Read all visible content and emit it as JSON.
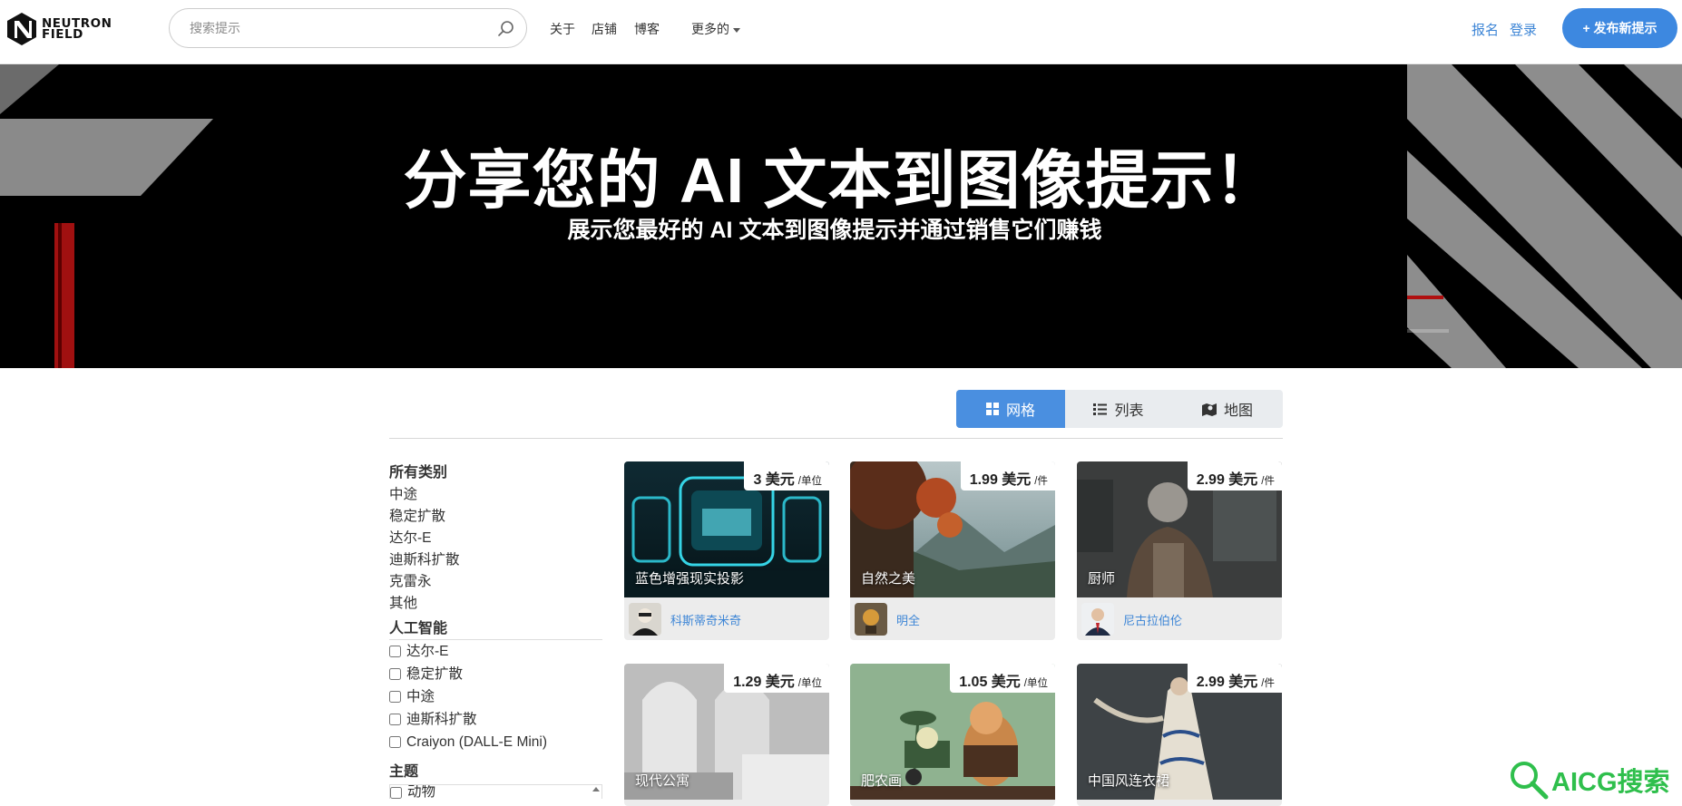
{
  "header": {
    "logo_line1": "NEUTRON",
    "logo_line2": "FIELD",
    "search_placeholder": "搜索提示",
    "nav": {
      "about": "关于",
      "shop": "店铺",
      "blog": "博客",
      "more": "更多的"
    },
    "auth": {
      "signup": "报名",
      "login": "登录"
    },
    "post_button": "+ 发布新提示",
    "accent": "#3d88e0"
  },
  "hero": {
    "title": "分享您的 AI 文本到图像提示！",
    "subtitle": "展示您最好的 AI 文本到图像提示并通过销售它们赚钱"
  },
  "views": {
    "grid": "网格",
    "list": "列表",
    "map": "地图",
    "active": "grid"
  },
  "sidebar": {
    "categories_heading": "所有类别",
    "categories": [
      "中途",
      "稳定扩散",
      "达尔-E",
      "迪斯科扩散",
      "克雷永",
      "其他"
    ],
    "ai_heading": "人工智能",
    "ai_options": [
      "达尔-E",
      "稳定扩散",
      "中途",
      "迪斯科扩散",
      "Craiyon (DALL-E Mini)"
    ],
    "theme_heading": "主题",
    "theme_options": [
      "动物"
    ]
  },
  "cards": [
    {
      "title": "蓝色增强现实投影",
      "price": "3 美元",
      "unit": "/单位",
      "seller": "科斯蒂奇米奇",
      "theme": "hologram"
    },
    {
      "title": "自然之美",
      "price": "1.99 美元",
      "unit": "/件",
      "seller": "明全",
      "theme": "nature"
    },
    {
      "title": "厨师",
      "price": "2.99 美元",
      "unit": "/件",
      "seller": "尼古拉伯伦",
      "theme": "chef"
    },
    {
      "title": "现代公寓",
      "price": "1.29 美元",
      "unit": "/单位",
      "seller": "",
      "theme": "interior"
    },
    {
      "title": "肥农画",
      "price": "1.05 美元",
      "unit": "/单位",
      "seller": "",
      "theme": "farmer"
    },
    {
      "title": "中国风连衣裙",
      "price": "2.99 美元",
      "unit": "/件",
      "seller": "",
      "theme": "dress"
    }
  ],
  "watermark": {
    "text": "AICG搜索",
    "color": "#2fbf4c"
  }
}
